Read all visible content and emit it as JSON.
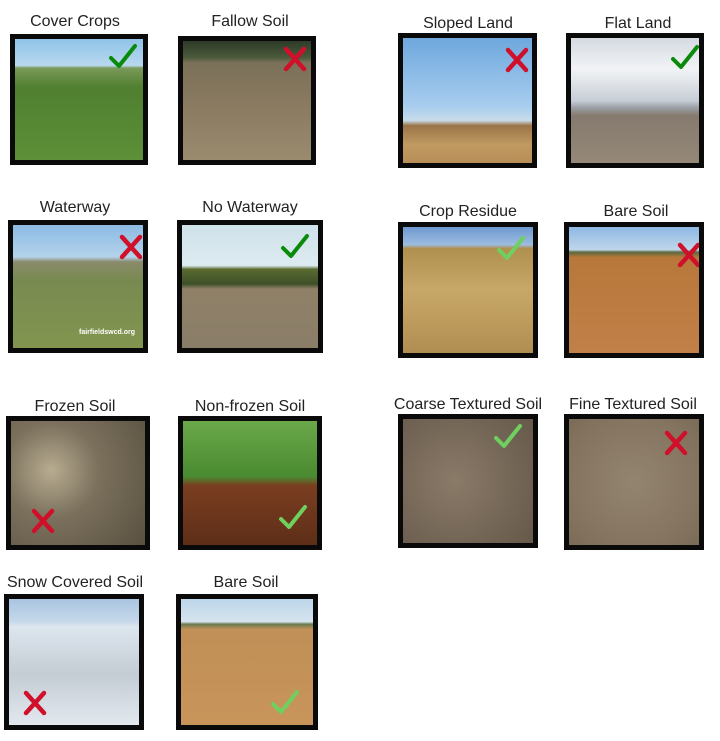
{
  "colors": {
    "x_red": "#d0102a",
    "check_dark_green": "#0a8a0a",
    "check_light_green": "#6fcf5f"
  },
  "cards": [
    {
      "label": "Cover Crops",
      "verdict": "check",
      "check_color": "dark"
    },
    {
      "label": "Fallow Soil",
      "verdict": "x"
    },
    {
      "label": "Sloped Land",
      "verdict": "x"
    },
    {
      "label": "Flat Land",
      "verdict": "check",
      "check_color": "dark"
    },
    {
      "label": "Waterway",
      "verdict": "x",
      "watermark": "fairfieldswcd.org"
    },
    {
      "label": "No Waterway",
      "verdict": "check",
      "check_color": "dark"
    },
    {
      "label": "Crop Residue",
      "verdict": "check",
      "check_color": "light"
    },
    {
      "label": "Bare Soil",
      "verdict": "x"
    },
    {
      "label": "Frozen Soil",
      "verdict": "x"
    },
    {
      "label": "Non-frozen Soil",
      "verdict": "check",
      "check_color": "light"
    },
    {
      "label": "Coarse Textured Soil",
      "verdict": "check",
      "check_color": "light"
    },
    {
      "label": "Fine Textured Soil",
      "verdict": "x"
    },
    {
      "label": "Snow Covered Soil",
      "verdict": "x"
    },
    {
      "label": "Bare Soil",
      "verdict": "check",
      "check_color": "light"
    }
  ]
}
